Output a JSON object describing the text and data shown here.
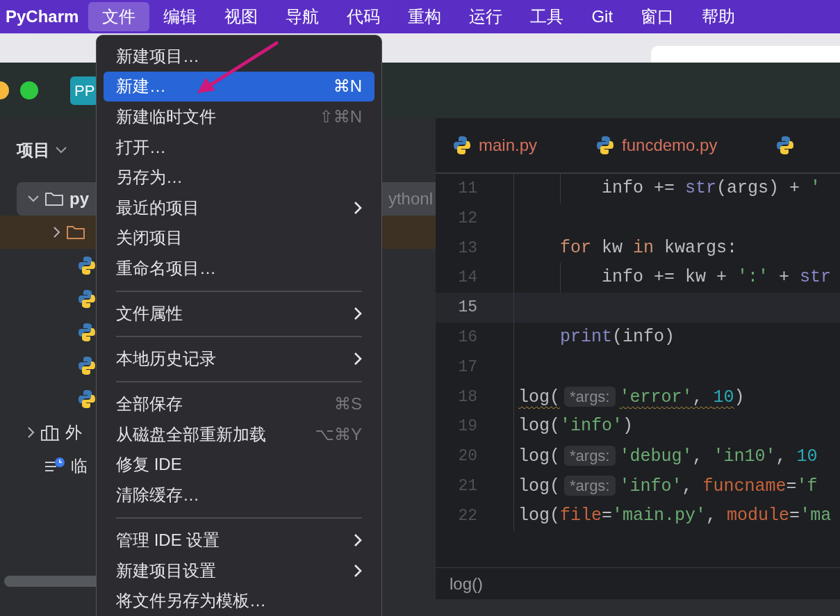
{
  "menu_bar": {
    "app_name": "PyCharm",
    "items": [
      {
        "label": "文件",
        "selected": true
      },
      {
        "label": "编辑",
        "selected": false
      },
      {
        "label": "视图",
        "selected": false
      },
      {
        "label": "导航",
        "selected": false
      },
      {
        "label": "代码",
        "selected": false
      },
      {
        "label": "重构",
        "selected": false
      },
      {
        "label": "运行",
        "selected": false
      },
      {
        "label": "工具",
        "selected": false
      },
      {
        "label": "Git",
        "selected": false
      },
      {
        "label": "窗口",
        "selected": false
      },
      {
        "label": "帮助",
        "selected": false
      }
    ]
  },
  "title_bar": {
    "project_badge": "PP"
  },
  "project_panel": {
    "title": "项目",
    "tree": [
      {
        "kind": "folder",
        "label": "py",
        "path": "ythonl",
        "expanded": true,
        "selected": true,
        "children": [
          {
            "kind": "folder",
            "expanded": false,
            "excluded": true,
            "selected": false
          },
          {
            "kind": "python_file",
            "selected": false
          },
          {
            "kind": "python_file",
            "selected": false
          },
          {
            "kind": "python_file",
            "selected": false
          },
          {
            "kind": "python_file",
            "selected": false
          },
          {
            "kind": "python_file",
            "selected": false
          }
        ]
      },
      {
        "kind": "library",
        "label": "外",
        "expanded": false,
        "selected": false
      },
      {
        "kind": "scratches",
        "label": "临",
        "selected": false
      }
    ]
  },
  "editor": {
    "tabs": [
      {
        "label": "main.py",
        "has_errors": true
      },
      {
        "label": "funcdemo.py",
        "has_errors": true
      }
    ],
    "lines": [
      {
        "number": "11",
        "current": false,
        "tokens": [
          {
            "kind": "indent"
          },
          {
            "kind": "indent"
          },
          {
            "kind": "plain",
            "text": "info += "
          },
          {
            "kind": "builtin",
            "text": "str"
          },
          {
            "kind": "plain",
            "text": "(args) + "
          },
          {
            "kind": "string",
            "text": "'"
          }
        ]
      },
      {
        "number": "12",
        "current": false
      },
      {
        "number": "13",
        "current": false,
        "tokens": [
          {
            "kind": "indent"
          },
          {
            "kind": "keyword",
            "text": "for"
          },
          {
            "kind": "plain",
            "text": " kw "
          },
          {
            "kind": "keyword",
            "text": "in"
          },
          {
            "kind": "plain",
            "text": " kwargs:"
          }
        ]
      },
      {
        "number": "14",
        "current": false,
        "tokens": [
          {
            "kind": "indent"
          },
          {
            "kind": "indent"
          },
          {
            "kind": "plain",
            "text": "info += kw + "
          },
          {
            "kind": "string",
            "text": "':'"
          },
          {
            "kind": "plain",
            "text": " + "
          },
          {
            "kind": "builtin",
            "text": "str"
          }
        ]
      },
      {
        "number": "15",
        "current": true
      },
      {
        "number": "16",
        "current": false,
        "tokens": [
          {
            "kind": "indent"
          },
          {
            "kind": "builtin",
            "text": "print"
          },
          {
            "kind": "plain",
            "text": "(info)"
          }
        ]
      },
      {
        "number": "17",
        "current": false
      },
      {
        "number": "18",
        "current": false,
        "tokens": [
          {
            "kind": "plain",
            "text": "log(",
            "warn": true
          },
          {
            "kind": "hint",
            "text": "*args:"
          },
          {
            "kind": "string",
            "text": "'error'",
            "warn": true
          },
          {
            "kind": "plain",
            "text": ", ",
            "warn": true
          },
          {
            "kind": "number",
            "text": "10",
            "warn": true
          },
          {
            "kind": "plain",
            "text": ")"
          }
        ]
      },
      {
        "number": "19",
        "current": false,
        "tokens": [
          {
            "kind": "plain",
            "text": "log("
          },
          {
            "kind": "string",
            "text": "'info'"
          },
          {
            "kind": "plain",
            "text": ")"
          }
        ]
      },
      {
        "number": "20",
        "current": false,
        "tokens": [
          {
            "kind": "plain",
            "text": "log("
          },
          {
            "kind": "hint",
            "text": "*args:"
          },
          {
            "kind": "string",
            "text": "'debug'"
          },
          {
            "kind": "plain",
            "text": ", "
          },
          {
            "kind": "string",
            "text": "'in10'"
          },
          {
            "kind": "plain",
            "text": ", "
          },
          {
            "kind": "number",
            "text": "10"
          }
        ]
      },
      {
        "number": "21",
        "current": false,
        "tokens": [
          {
            "kind": "plain",
            "text": "log("
          },
          {
            "kind": "hint",
            "text": "*args:"
          },
          {
            "kind": "string",
            "text": "'info'"
          },
          {
            "kind": "plain",
            "text": ", "
          },
          {
            "kind": "param",
            "text": "funcname"
          },
          {
            "kind": "plain",
            "text": "="
          },
          {
            "kind": "string",
            "text": "'f"
          }
        ]
      },
      {
        "number": "22",
        "current": false,
        "tokens": [
          {
            "kind": "plain",
            "text": "log("
          },
          {
            "kind": "param",
            "text": "file"
          },
          {
            "kind": "plain",
            "text": "="
          },
          {
            "kind": "string",
            "text": "'main.py'"
          },
          {
            "kind": "plain",
            "text": ", "
          },
          {
            "kind": "param",
            "text": "module"
          },
          {
            "kind": "plain",
            "text": "="
          },
          {
            "kind": "string",
            "text": "'ma"
          }
        ]
      }
    ],
    "breadcrumb": "log()"
  },
  "file_menu": {
    "items": [
      {
        "kind": "item",
        "label": "新建项目…",
        "submenu": false,
        "selected": false
      },
      {
        "kind": "item",
        "label": "新建…",
        "shortcut": "⌘N",
        "submenu": false,
        "selected": true
      },
      {
        "kind": "item",
        "label": "新建临时文件",
        "shortcut": "⇧⌘N",
        "submenu": false,
        "selected": false
      },
      {
        "kind": "item",
        "label": "打开…",
        "submenu": false,
        "selected": false
      },
      {
        "kind": "item",
        "label": "另存为…",
        "submenu": false,
        "selected": false
      },
      {
        "kind": "item",
        "label": "最近的项目",
        "submenu": true,
        "selected": false
      },
      {
        "kind": "item",
        "label": "关闭项目",
        "submenu": false,
        "selected": false
      },
      {
        "kind": "item",
        "label": "重命名项目…",
        "submenu": false,
        "selected": false
      },
      {
        "kind": "separator"
      },
      {
        "kind": "item",
        "label": "文件属性",
        "submenu": true,
        "selected": false
      },
      {
        "kind": "separator"
      },
      {
        "kind": "item",
        "label": "本地历史记录",
        "submenu": true,
        "selected": false
      },
      {
        "kind": "separator"
      },
      {
        "kind": "item",
        "label": "全部保存",
        "shortcut": "⌘S",
        "submenu": false,
        "selected": false
      },
      {
        "kind": "item",
        "label": "从磁盘全部重新加载",
        "shortcut": "⌥⌘Y",
        "submenu": false,
        "selected": false
      },
      {
        "kind": "item",
        "label": "修复 IDE",
        "submenu": false,
        "selected": false
      },
      {
        "kind": "item",
        "label": "清除缓存…",
        "submenu": false,
        "selected": false
      },
      {
        "kind": "separator"
      },
      {
        "kind": "item",
        "label": "管理 IDE 设置",
        "submenu": true,
        "selected": false
      },
      {
        "kind": "item",
        "label": "新建项目设置",
        "submenu": true,
        "selected": false
      },
      {
        "kind": "item",
        "label": "将文件另存为模板…",
        "submenu": false,
        "selected": false
      }
    ]
  }
}
